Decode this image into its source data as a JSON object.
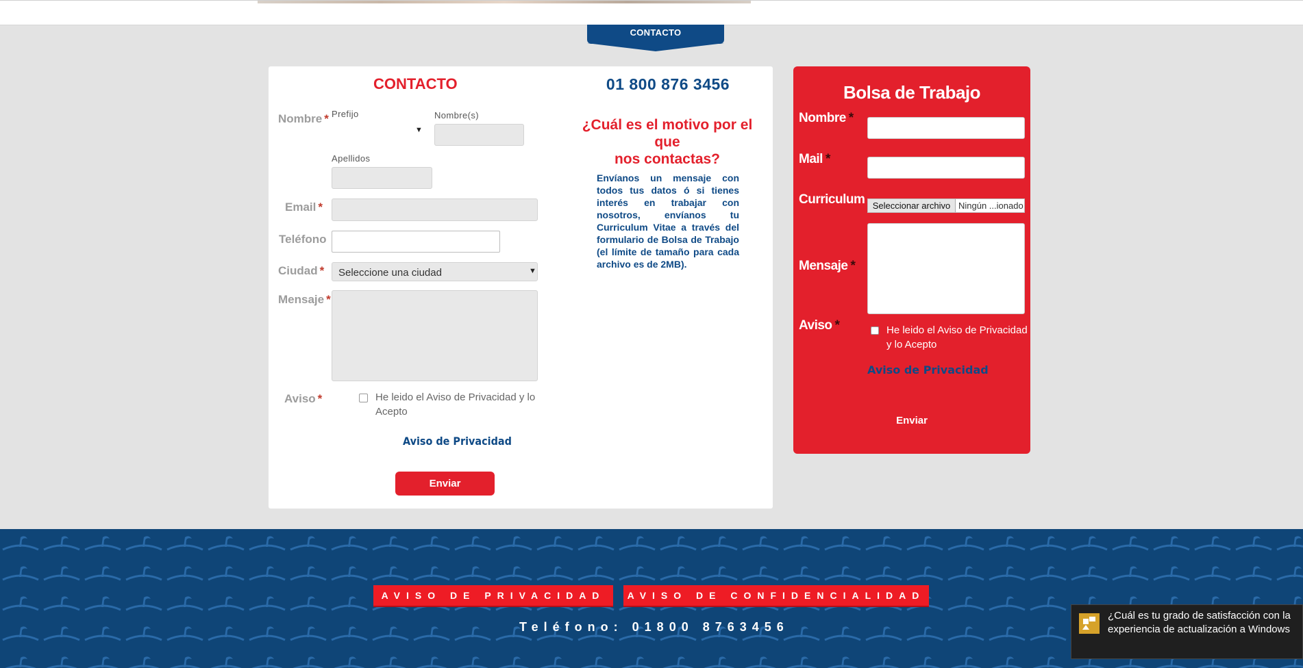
{
  "header": {
    "tab_label": "CONTACTO"
  },
  "contact_form": {
    "title": "CONTACTO",
    "phone": "01 800 876 3456",
    "labels": {
      "nombre": "Nombre",
      "email": "Email",
      "telefono": "Teléfono",
      "ciudad": "Ciudad",
      "mensaje": "Mensaje",
      "aviso": "Aviso",
      "required": "*"
    },
    "sublabels": {
      "prefijo": "Prefijo",
      "nombres": "Nombre(s)",
      "apellidos": "Apellidos"
    },
    "ciudad_select": "Seleccione una ciudad",
    "checkbox_text_line1": "He leido el Aviso de Privacidad y lo",
    "checkbox_text_line2": "Acepto",
    "privacy_link": "Aviso de Privacidad",
    "submit": "Enviar"
  },
  "info": {
    "question_line1": "¿Cuál es el motivo por el que",
    "question_line2": "nos contactas?",
    "body": "Envíanos un mensaje con todos tus datos ó si tienes interés en trabajar con nosotros, envíanos tu Curriculum Vitae a través del formulario de Bolsa de Trabajo (el límite de tamaño para cada archivo es de 2MB)."
  },
  "bolsa": {
    "title": "Bolsa de Trabajo",
    "labels": {
      "nombre": "Nombre",
      "mail": "Mail",
      "curriculum": "Curriculum",
      "mensaje": "Mensaje",
      "aviso": "Aviso",
      "required": "*"
    },
    "file_button": "Seleccionar archivo",
    "file_status": "Ningún ...ionado",
    "checkbox_text_line1": "He leido el Aviso de Privacidad",
    "checkbox_text_line2": "y lo Acepto",
    "privacy_link": "Aviso de Privacidad",
    "submit": "Enviar"
  },
  "footer": {
    "privacy_button": "AVISO DE PRIVACIDAD",
    "confidential_button": "AVISO DE CONFIDENCIALIDAD",
    "phone": "Teléfono: 01800 8763456"
  },
  "toast": {
    "text": "¿Cuál es tu grado de satisfacción con la experiencia de actualización a Windows"
  },
  "colors": {
    "red": "#e3202c",
    "blue": "#0f4a86",
    "footer_bg": "#0f4577",
    "page_bg": "#e3e3e3"
  }
}
